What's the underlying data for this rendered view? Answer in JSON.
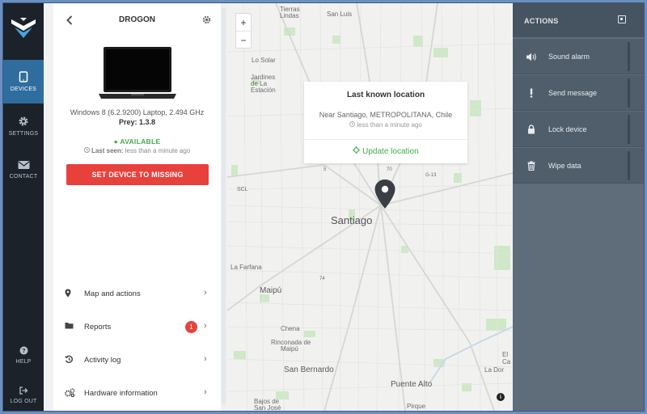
{
  "nav": {
    "logo": "prey-logo",
    "items": [
      {
        "label": "DEVICES",
        "icon": "device-icon",
        "active": true
      },
      {
        "label": "SETTINGS",
        "icon": "gear-icon",
        "active": false
      },
      {
        "label": "CONTACT",
        "icon": "envelope-icon",
        "active": false
      }
    ],
    "bottom": [
      {
        "label": "HELP",
        "icon": "question-icon"
      },
      {
        "label": "LOG OUT",
        "icon": "logout-icon"
      }
    ]
  },
  "device": {
    "name": "DROGON",
    "spec": "Windows 8 (6.2.9200) Laptop, 2.494 GHz",
    "prey_version": "Prey: 1.3.8",
    "status": "AVAILABLE",
    "last_seen_label": "Last seen:",
    "last_seen_value": "less than a minute ago",
    "missing_button": "SET DEVICE TO MISSING"
  },
  "menu": [
    {
      "label": "Map and actions",
      "icon": "map-pin-icon"
    },
    {
      "label": "Reports",
      "icon": "folder-icon",
      "badge": "1"
    },
    {
      "label": "Activity log",
      "icon": "history-icon"
    },
    {
      "label": "Hardware information",
      "icon": "cogs-icon"
    }
  ],
  "map": {
    "zoom_in": "+",
    "zoom_out": "−",
    "card": {
      "title": "Last known location",
      "address": "Near Santiago, METROPOLITANA, Chile",
      "time": "less than a minute ago",
      "update": "Update location"
    },
    "labels": {
      "tierras": "Tierras",
      "lindas": "Lindas",
      "san_luis": "San Luis",
      "lo_solar": "Lo Solar",
      "jardines": "Jardines",
      "de_la": "de La",
      "estacion": "Estación",
      "scl": "SCL",
      "santiago": "Santiago",
      "la_farfana": "La Farfana",
      "maipu": "Maipú",
      "chena": "Chena",
      "rinconada": "Rinconada de",
      "maipu2": "Maipú",
      "san_bernardo": "San Bernardo",
      "puente_alto": "Puente Alto",
      "bajos_de": "Bajos de",
      "san_jose": "San José",
      "pirque": "Pirque",
      "el_ca": "El Ca",
      "la_dor": "La Dor",
      "r5": "5",
      "r70": "70",
      "g13": "G-13",
      "r74": "74"
    },
    "info": "i"
  },
  "actions": {
    "title": "ACTIONS",
    "items": [
      {
        "label": "Sound alarm",
        "icon": "speaker-icon"
      },
      {
        "label": "Send message",
        "icon": "exclamation-icon"
      },
      {
        "label": "Lock device",
        "icon": "lock-icon"
      },
      {
        "label": "Wipe data",
        "icon": "trash-icon"
      }
    ]
  },
  "colors": {
    "accent_blue": "#2e6d9e",
    "danger": "#e8413b",
    "success": "#3fae49",
    "nav_bg": "#1c2229",
    "actions_bg": "#5f6c79"
  }
}
